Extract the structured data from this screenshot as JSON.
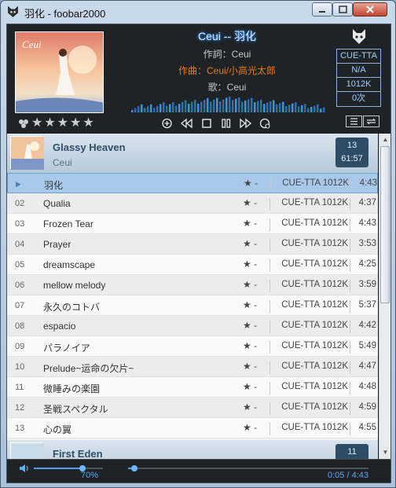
{
  "window": {
    "title": "羽化 - foobar2000"
  },
  "now_playing": {
    "title_line": "Ceui -- 羽化",
    "lyricist": "作詞：Ceui",
    "composer": "作曲：Ceui/小高光太郎",
    "singer": "歌：Ceui",
    "rating_stars": 0,
    "info": [
      "CUE-TTA",
      "N/A",
      "1012K",
      "0次"
    ]
  },
  "colors": {
    "accent": "#4aa0ef",
    "composer": "#e07d1e",
    "playing_row": "#a9c9ea",
    "group_badge": "#2e4c66"
  },
  "icons": {
    "volume": "speaker-icon",
    "logo": "foobar-logo-icon",
    "add": "add-icon",
    "prev": "previous-icon",
    "stop": "stop-icon",
    "pause": "pause-icon",
    "next": "next-icon",
    "random": "random-icon",
    "list": "list-icon",
    "repeat": "repeat-icon"
  },
  "groups": [
    {
      "album": "Glassy Heaven",
      "artist": "Ceui",
      "count": "13",
      "duration": "61:57",
      "tracks": [
        {
          "num": "",
          "title": "羽化",
          "rating": "★ -",
          "codec": "CUE-TTA 1012K",
          "length": "4:43",
          "playing": true
        },
        {
          "num": "02",
          "title": "Qualia",
          "rating": "★ -",
          "codec": "CUE-TTA 1012K",
          "length": "4:37"
        },
        {
          "num": "03",
          "title": "Frozen Tear",
          "rating": "★ -",
          "codec": "CUE-TTA 1012K",
          "length": "4:43"
        },
        {
          "num": "04",
          "title": "Prayer",
          "rating": "★ -",
          "codec": "CUE-TTA 1012K",
          "length": "3:53"
        },
        {
          "num": "05",
          "title": "dreamscape",
          "rating": "★ -",
          "codec": "CUE-TTA 1012K",
          "length": "4:25"
        },
        {
          "num": "06",
          "title": "mellow melody",
          "rating": "★ -",
          "codec": "CUE-TTA 1012K",
          "length": "3:59"
        },
        {
          "num": "07",
          "title": "永久のコトバ",
          "rating": "★ -",
          "codec": "CUE-TTA 1012K",
          "length": "5:37"
        },
        {
          "num": "08",
          "title": "espacio",
          "rating": "★ -",
          "codec": "CUE-TTA 1012K",
          "length": "4:42"
        },
        {
          "num": "09",
          "title": "パラノイア",
          "rating": "★ -",
          "codec": "CUE-TTA 1012K",
          "length": "5:49"
        },
        {
          "num": "10",
          "title": "Prelude~运命の欠片~",
          "rating": "★ -",
          "codec": "CUE-TTA 1012K",
          "length": "4:47"
        },
        {
          "num": "11",
          "title": "微睡みの楽園",
          "rating": "★ -",
          "codec": "CUE-TTA 1012K",
          "length": "4:48"
        },
        {
          "num": "12",
          "title": "圣戦スペクタル",
          "rating": "★ -",
          "codec": "CUE-TTA 1012K",
          "length": "4:59"
        },
        {
          "num": "13",
          "title": "心の翼",
          "rating": "★ -",
          "codec": "CUE-TTA 1012K",
          "length": "4:55"
        }
      ]
    },
    {
      "album": "First Eden",
      "count": "11"
    }
  ],
  "playback": {
    "volume_label": "70%",
    "volume_fraction": 0.7,
    "time_label": "0:05 / 4:43",
    "progress_fraction": 0.018
  }
}
